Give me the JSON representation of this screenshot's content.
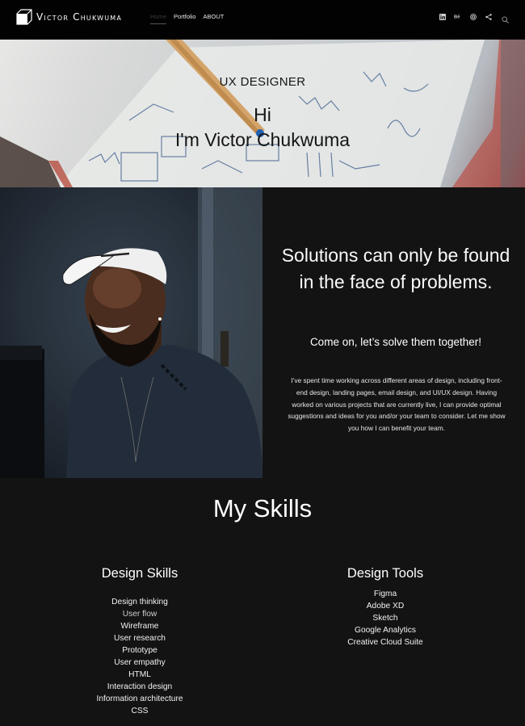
{
  "header": {
    "logo_icon": "cube-icon",
    "logo_text": "Victor Chukwuma",
    "nav": [
      {
        "label": "Home",
        "active": true
      },
      {
        "label": "Portfolio",
        "active": false
      },
      {
        "label": "ABOUT",
        "active": false
      }
    ],
    "social_icons": [
      "linkedin-icon",
      "behance-icon",
      "instagram-icon",
      "share-icon"
    ],
    "search_icon": "search-icon"
  },
  "hero": {
    "subtitle": "UX DESIGNER",
    "greeting": "Hi",
    "name_line": "I'm Victor Chukwuma"
  },
  "about": {
    "quote": "Solutions can only be found in the face of problems.",
    "tagline": "Come on, let’s solve them together!",
    "bio": "I’ve spent time working across different areas of design, including front-end design, landing pages, email design, and UI/UX design. Having worked on various projects that are currently live, I can provide optimal suggestions and ideas for you and/or your team to consider. Let me show you how I can benefit your team."
  },
  "skills": {
    "title": "My Skills",
    "design_skills": {
      "title": "Design Skills",
      "items": [
        "Design thinking",
        "User flow",
        "Wireframe",
        "User research",
        "Prototype",
        "User empathy",
        "HTML",
        "Interaction design",
        "Information architecture",
        "CSS"
      ]
    },
    "design_tools": {
      "title": "Design Tools",
      "items": [
        "Figma",
        "Adobe XD",
        "Sketch",
        "Google Analytics",
        "Creative Cloud Suite"
      ]
    }
  },
  "colors": {
    "header_bg": "#020202",
    "page_bg": "#131313",
    "text": "#ffffff"
  }
}
